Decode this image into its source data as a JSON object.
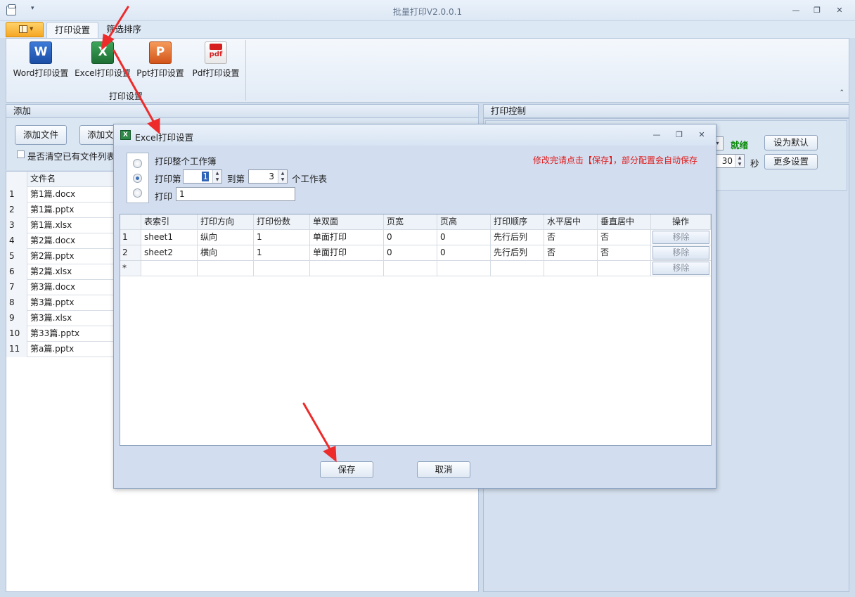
{
  "app": {
    "title": "批量打印V2.0.0.1"
  },
  "ribbon": {
    "tabs": [
      {
        "label": "打印设置"
      },
      {
        "label": "筛选排序"
      }
    ],
    "buttons": [
      {
        "label": "Word打印设置",
        "icon": "word-icon",
        "glyph": "W"
      },
      {
        "label": "Excel打印设置",
        "icon": "excel-icon",
        "glyph": "X"
      },
      {
        "label": "Ppt打印设置",
        "icon": "ppt-icon",
        "glyph": "P"
      },
      {
        "label": "Pdf打印设置",
        "icon": "pdf-icon",
        "glyph": "pdf"
      }
    ],
    "group_label": "打印设置"
  },
  "left": {
    "header": "添加",
    "add_file": "添加文件",
    "add_folder": "添加文",
    "clear_checkbox": "是否清空已有文件列表",
    "grid": {
      "column": "文件名",
      "rows": [
        {
          "idx": "1",
          "name": "第1篇.docx"
        },
        {
          "idx": "2",
          "name": "第1篇.pptx"
        },
        {
          "idx": "3",
          "name": "第1篇.xlsx"
        },
        {
          "idx": "4",
          "name": "第2篇.docx"
        },
        {
          "idx": "5",
          "name": "第2篇.pptx"
        },
        {
          "idx": "6",
          "name": "第2篇.xlsx"
        },
        {
          "idx": "7",
          "name": "第3篇.docx"
        },
        {
          "idx": "8",
          "name": "第3篇.pptx"
        },
        {
          "idx": "9",
          "name": "第3篇.xlsx"
        },
        {
          "idx": "10",
          "name": "第33篇.pptx"
        },
        {
          "idx": "11",
          "name": "第a篇.pptx"
        }
      ]
    }
  },
  "right": {
    "header": "打印控制",
    "status": "就绪",
    "status_color": "#0a8a0a",
    "set_default": "设为默认",
    "more_settings": "更多设置",
    "interval_value": "30",
    "interval_unit": "秒"
  },
  "dialog": {
    "title": "Excel打印设置",
    "option_whole": "打印整个工作簿",
    "range_prefix": "打印第",
    "range_from": "1",
    "range_mid": "到第",
    "range_to": "3",
    "range_suffix": "个工作表",
    "print_label": "打印",
    "print_value": "1",
    "note": "修改完请点击【保存】，部分配置会自动保存",
    "note_color": "#e01b1b",
    "columns": [
      "表索引",
      "打印方向",
      "打印份数",
      "单双面",
      "页宽",
      "页高",
      "打印顺序",
      "水平居中",
      "垂直居中",
      "操作"
    ],
    "rows": [
      {
        "idx": "1",
        "cells": [
          "sheet1",
          "纵向",
          "1",
          "单面打印",
          "0",
          "0",
          "先行后列",
          "否",
          "否"
        ],
        "action": "移除"
      },
      {
        "idx": "2",
        "cells": [
          "sheet2",
          "横向",
          "1",
          "单面打印",
          "0",
          "0",
          "先行后列",
          "否",
          "否"
        ],
        "action": "移除"
      },
      {
        "idx": "*",
        "cells": [
          "",
          "",
          "",
          "",
          "",
          "",
          "",
          "",
          ""
        ],
        "action": "移除"
      }
    ],
    "save": "保存",
    "cancel": "取消"
  }
}
